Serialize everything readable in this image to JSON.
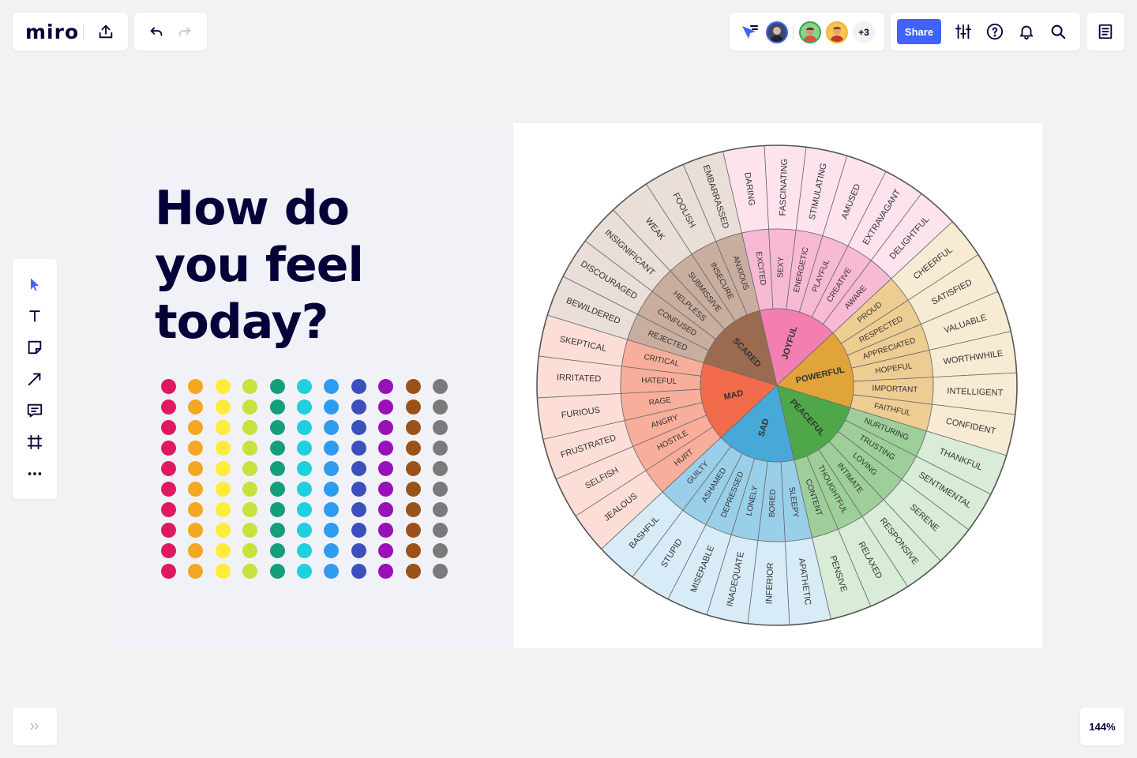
{
  "app": {
    "logo": "miro",
    "zoom": "144%",
    "share_label": "Share",
    "more_users": "+3"
  },
  "icons": {
    "export": "upload-icon",
    "undo": "undo-icon",
    "redo": "redo-icon",
    "cursor": "cursor-tracking-icon",
    "settings": "sliders-icon",
    "help": "help-icon",
    "notifications": "bell-icon",
    "search": "search-icon",
    "notes": "notes-icon",
    "expand": "double-chevron-right-icon"
  },
  "left_toolbar": [
    {
      "name": "select-tool",
      "icon": "pointer-icon"
    },
    {
      "name": "text-tool",
      "icon": "text-icon"
    },
    {
      "name": "sticky-note-tool",
      "icon": "sticky-note-icon"
    },
    {
      "name": "line-tool",
      "icon": "arrow-line-icon"
    },
    {
      "name": "comment-tool",
      "icon": "comment-icon"
    },
    {
      "name": "frame-tool",
      "icon": "frame-icon"
    },
    {
      "name": "more-tools",
      "icon": "more-dots-icon"
    }
  ],
  "board": {
    "heading_lines": [
      "How do",
      "you feel",
      "today?"
    ],
    "dot_colors": [
      "#e0195e",
      "#f5a623",
      "#ffeb3b",
      "#c6e23c",
      "#139e7c",
      "#1fd0de",
      "#2d9bf0",
      "#3c4fbd",
      "#9810b8",
      "#9b5219",
      "#7a7a7a"
    ],
    "dot_rows": 10
  },
  "wheel": {
    "colors": {
      "mad": "#f26b4a",
      "scared": "#9c6a4e",
      "joyful": "#f27fb0",
      "powerful": "#e0a43b",
      "peaceful": "#4ea84a",
      "sad": "#48a8d8"
    },
    "core": [
      {
        "label": "MAD",
        "color_key": "mad"
      },
      {
        "label": "SCARED",
        "color_key": "scared"
      },
      {
        "label": "JOYFUL",
        "color_key": "joyful"
      },
      {
        "label": "POWERFUL",
        "color_key": "powerful"
      },
      {
        "label": "PEACEFUL",
        "color_key": "peaceful"
      },
      {
        "label": "SAD",
        "color_key": "sad"
      }
    ],
    "middle": [
      {
        "label": "HURT",
        "color_key": "mad"
      },
      {
        "label": "HOSTILE",
        "color_key": "mad"
      },
      {
        "label": "ANGRY",
        "color_key": "mad"
      },
      {
        "label": "RAGE",
        "color_key": "mad"
      },
      {
        "label": "HATEFUL",
        "color_key": "mad"
      },
      {
        "label": "CRITICAL",
        "color_key": "mad"
      },
      {
        "label": "REJECTED",
        "color_key": "scared"
      },
      {
        "label": "CONFUSED",
        "color_key": "scared"
      },
      {
        "label": "HELPLESS",
        "color_key": "scared"
      },
      {
        "label": "SUBMISSIVE",
        "color_key": "scared"
      },
      {
        "label": "INSECURE",
        "color_key": "scared"
      },
      {
        "label": "ANXIOUS",
        "color_key": "scared"
      },
      {
        "label": "EXCITED",
        "color_key": "joyful"
      },
      {
        "label": "SEXY",
        "color_key": "joyful"
      },
      {
        "label": "ENERGETIC",
        "color_key": "joyful"
      },
      {
        "label": "PLAYFUL",
        "color_key": "joyful"
      },
      {
        "label": "CREATIVE",
        "color_key": "joyful"
      },
      {
        "label": "AWARE",
        "color_key": "joyful"
      },
      {
        "label": "PROUD",
        "color_key": "powerful"
      },
      {
        "label": "RESPECTED",
        "color_key": "powerful"
      },
      {
        "label": "APPRECIATED",
        "color_key": "powerful"
      },
      {
        "label": "HOPEFUL",
        "color_key": "powerful"
      },
      {
        "label": "IMPORTANT",
        "color_key": "powerful"
      },
      {
        "label": "FAITHFUL",
        "color_key": "powerful"
      },
      {
        "label": "NURTURING",
        "color_key": "peaceful"
      },
      {
        "label": "TRUSTING",
        "color_key": "peaceful"
      },
      {
        "label": "LOVING",
        "color_key": "peaceful"
      },
      {
        "label": "INTIMATE",
        "color_key": "peaceful"
      },
      {
        "label": "THOUGHTFUL",
        "color_key": "peaceful"
      },
      {
        "label": "CONTENT",
        "color_key": "peaceful"
      },
      {
        "label": "SLEEPY",
        "color_key": "sad"
      },
      {
        "label": "BORED",
        "color_key": "sad"
      },
      {
        "label": "LONELY",
        "color_key": "sad"
      },
      {
        "label": "DEPRESSED",
        "color_key": "sad"
      },
      {
        "label": "ASHAMED",
        "color_key": "sad"
      },
      {
        "label": "GUILTY",
        "color_key": "sad"
      }
    ],
    "outer": [
      {
        "label": "JEALOUS",
        "color_key": "mad"
      },
      {
        "label": "SELFISH",
        "color_key": "mad"
      },
      {
        "label": "FRUSTRATED",
        "color_key": "mad"
      },
      {
        "label": "FURIOUS",
        "color_key": "mad"
      },
      {
        "label": "IRRITATED",
        "color_key": "mad"
      },
      {
        "label": "SKEPTICAL",
        "color_key": "mad"
      },
      {
        "label": "BEWILDERED",
        "color_key": "scared"
      },
      {
        "label": "DISCOURAGED",
        "color_key": "scared"
      },
      {
        "label": "INSIGNIFICANT",
        "color_key": "scared"
      },
      {
        "label": "WEAK",
        "color_key": "scared"
      },
      {
        "label": "FOOLISH",
        "color_key": "scared"
      },
      {
        "label": "EMBARRASSED",
        "color_key": "scared"
      },
      {
        "label": "DARING",
        "color_key": "joyful"
      },
      {
        "label": "FASCINATING",
        "color_key": "joyful"
      },
      {
        "label": "STIMULATING",
        "color_key": "joyful"
      },
      {
        "label": "AMUSED",
        "color_key": "joyful"
      },
      {
        "label": "EXTRAVAGANT",
        "color_key": "joyful"
      },
      {
        "label": "DELIGHTFUL",
        "color_key": "joyful"
      },
      {
        "label": "CHEERFUL",
        "color_key": "powerful"
      },
      {
        "label": "SATISFIED",
        "color_key": "powerful"
      },
      {
        "label": "VALUABLE",
        "color_key": "powerful"
      },
      {
        "label": "WORTHWHILE",
        "color_key": "powerful"
      },
      {
        "label": "INTELLIGENT",
        "color_key": "powerful"
      },
      {
        "label": "CONFIDENT",
        "color_key": "powerful"
      },
      {
        "label": "THANKFUL",
        "color_key": "peaceful"
      },
      {
        "label": "SENTIMENTAL",
        "color_key": "peaceful"
      },
      {
        "label": "SERENE",
        "color_key": "peaceful"
      },
      {
        "label": "RESPONSIVE",
        "color_key": "peaceful"
      },
      {
        "label": "RELAXED",
        "color_key": "peaceful"
      },
      {
        "label": "PENSIVE",
        "color_key": "peaceful"
      },
      {
        "label": "APATHETIC",
        "color_key": "sad"
      },
      {
        "label": "INFERIOR",
        "color_key": "sad"
      },
      {
        "label": "INADEQUATE",
        "color_key": "sad"
      },
      {
        "label": "MISERABLE",
        "color_key": "sad"
      },
      {
        "label": "STUPID",
        "color_key": "sad"
      },
      {
        "label": "BASHFUL",
        "color_key": "sad"
      }
    ]
  }
}
